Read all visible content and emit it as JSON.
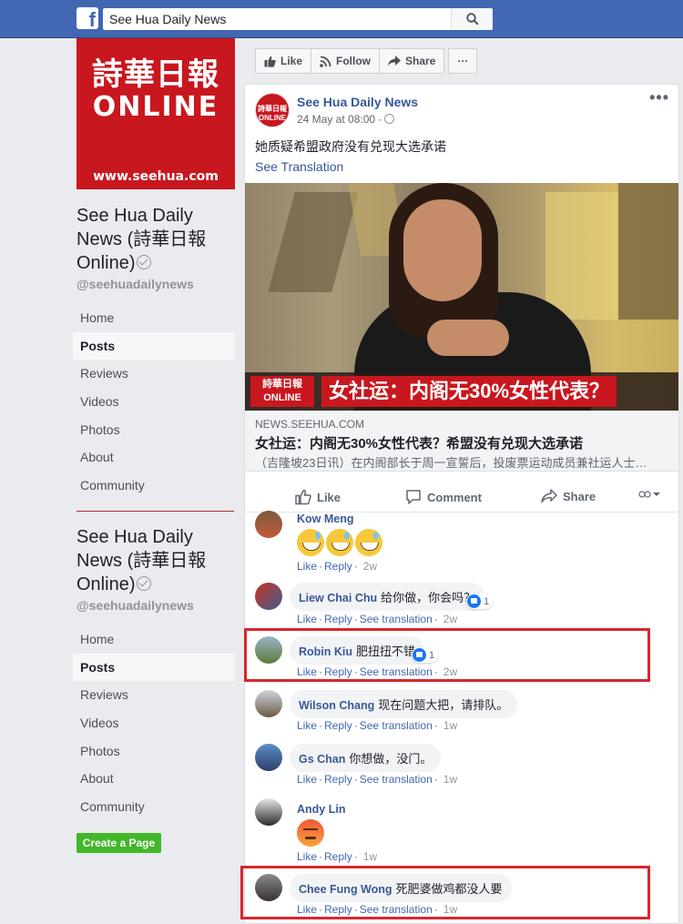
{
  "topbar": {
    "search_value": "See Hua Daily News",
    "logo_letter": "f"
  },
  "cover": {
    "name_cn": "詩華日報",
    "online": "ONLINE",
    "url": "www.seehua.com"
  },
  "page": {
    "name_line1": "See Hua Daily",
    "name_line2": "News (詩華日報",
    "name_line3": "Online)",
    "handle": "@seehuadailynews"
  },
  "nav": {
    "items": [
      "Home",
      "Posts",
      "Reviews",
      "Videos",
      "Photos",
      "About",
      "Community"
    ],
    "active": "Posts"
  },
  "create_page_label": "Create a Page",
  "actions": {
    "like": "Like",
    "follow": "Follow",
    "share": "Share",
    "more": "···"
  },
  "post": {
    "author": "See Hua Daily News",
    "time": "24 May at 08:00 ·",
    "text": "她质疑希盟政府没有兑现大选承诺",
    "see_translation": "See Translation",
    "more": "•••",
    "avatar_text": "詩華日報 ONLINE",
    "image": {
      "logo_text": "詩華日報 ONLINE",
      "headline": "女社运：内阁无30%女性代表？"
    },
    "link": {
      "domain": "NEWS.SEEHUA.COM",
      "title": "女社运：内阁无30%女性代表？希盟没有兑现大选承诺",
      "description": "（吉隆坡23日讯）在内阁部长于周一宣誓后，投废票运动成员兼社运人士…"
    },
    "reactions": {
      "like": "Like",
      "comment": "Comment",
      "share": "Share"
    }
  },
  "comments": [
    {
      "name": "Kow Meng",
      "text": "",
      "like": "Like",
      "reply": "Reply",
      "translate": "",
      "time": "2w",
      "likes": ""
    },
    {
      "name": "Liew Chai Chu",
      "text": "给你做，你会吗？",
      "like": "Like",
      "reply": "Reply",
      "translate": "See translation",
      "time": "2w",
      "likes": "1"
    },
    {
      "name": "Robin Kiu",
      "text": "肥扭扭不错",
      "like": "Like",
      "reply": "Reply",
      "translate": "See translation",
      "time": "2w",
      "likes": "1"
    },
    {
      "name": "Wilson Chang",
      "text": "现在问题大把，请排队。",
      "like": "Like",
      "reply": "Reply",
      "translate": "See translation",
      "time": "1w",
      "likes": ""
    },
    {
      "name": "Gs Chan",
      "text": "你想做，没门。",
      "like": "Like",
      "reply": "Reply",
      "translate": "See translation",
      "time": "1w",
      "likes": ""
    },
    {
      "name": "Andy Lin",
      "text": "",
      "like": "Like",
      "reply": "Reply",
      "translate": "",
      "time": "1w",
      "likes": ""
    },
    {
      "name": "Chee Fung Wong",
      "text": "死肥婆做鸡都没人要",
      "like": "Like",
      "reply": "Reply",
      "translate": "See translation",
      "time": "1w",
      "likes": ""
    }
  ],
  "colors": {
    "facebook_blue": "#4267b2",
    "link_blue": "#365899",
    "highlight_red": "#d9262e",
    "create_green": "#42b72a",
    "brand_red": "#c8171e"
  }
}
